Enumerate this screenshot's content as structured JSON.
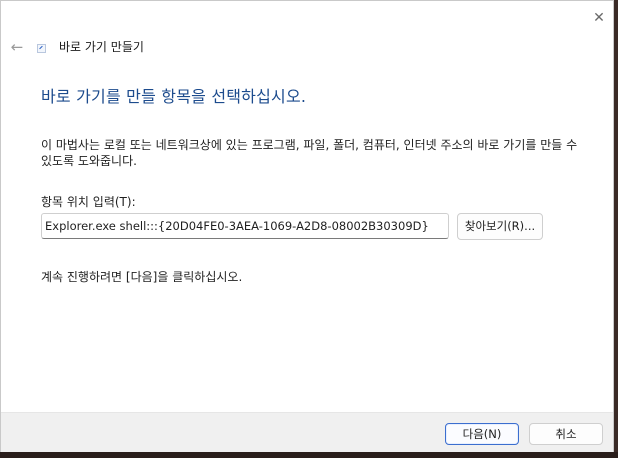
{
  "window": {
    "close_icon": "close-icon",
    "back_icon": "back-arrow-icon",
    "wizard_icon": "shortcut-icon",
    "title": "바로 가기 만들기"
  },
  "content": {
    "instruction": "바로 가기를 만들 항목을 선택하십시오.",
    "description": "이 마법사는 로컬 또는 네트워크상에 있는 프로그램, 파일, 폴더, 컴퓨터, 인터넷 주소의 바로 가기를 만들 수 있도록 도와줍니다.",
    "location_label": "항목 위치 입력(T):",
    "location_value": "Explorer.exe shell:::{20D04FE0-3AEA-1069-A2D8-08002B30309D}",
    "browse_button": "찾아보기(R)...",
    "continue_text": "계속 진행하려면 [다음]을 클릭하십시오."
  },
  "footer": {
    "next_button": "다음(N)",
    "cancel_button": "취소"
  }
}
